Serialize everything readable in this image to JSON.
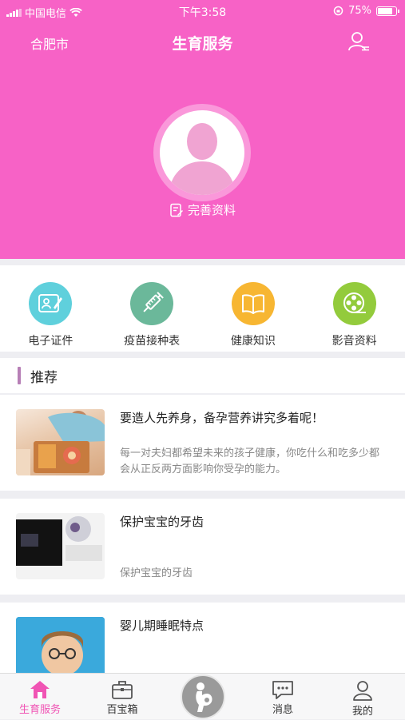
{
  "status_bar": {
    "carrier": "中国电信",
    "time": "下午3:58",
    "battery": "75%"
  },
  "nav": {
    "city": "合肥市",
    "title": "生育服务"
  },
  "profile": {
    "complete_label": "完善资料"
  },
  "quick_actions": [
    {
      "label": "电子证件",
      "color": "#5fd0dc",
      "icon": "id-card-icon"
    },
    {
      "label": "疫苗接种表",
      "color": "#6bb89a",
      "icon": "syringe-icon"
    },
    {
      "label": "健康知识",
      "color": "#f7b632",
      "icon": "book-icon"
    },
    {
      "label": "影音资料",
      "color": "#93cb3c",
      "icon": "film-reel-icon"
    }
  ],
  "recommend": {
    "title": "推荐",
    "articles": [
      {
        "title": "要造人先养身，备孕营养讲究多着呢！",
        "desc": "每一对夫妇都希望未来的孩子健康，你吃什么和吃多少都会从正反两方面影响你受孕的能力。"
      },
      {
        "title": "保护宝宝的牙齿",
        "desc": "保护宝宝的牙齿"
      },
      {
        "title": "婴儿期睡眠特点",
        "desc": ""
      }
    ]
  },
  "tabbar": {
    "items": [
      {
        "label": "生育服务",
        "icon": "home-icon"
      },
      {
        "label": "百宝箱",
        "icon": "toolbox-icon"
      },
      {
        "label": "",
        "icon": "pregnancy-icon"
      },
      {
        "label": "消息",
        "icon": "message-icon"
      },
      {
        "label": "我的",
        "icon": "profile-icon"
      }
    ]
  },
  "colors": {
    "brand_pink": "#f762c6",
    "active_tab": "#f054b4",
    "section_accent": "#b77fb6"
  }
}
